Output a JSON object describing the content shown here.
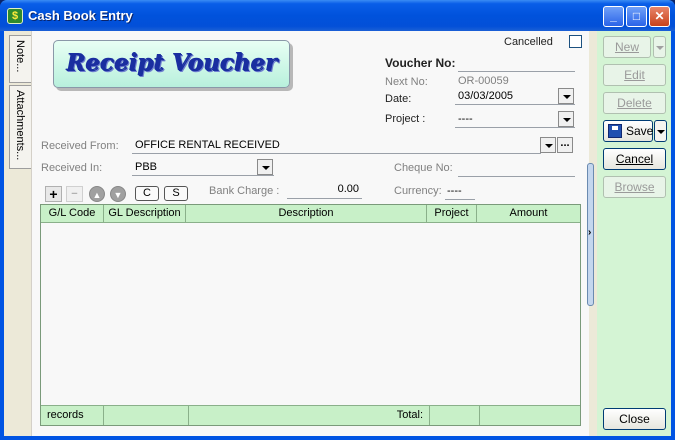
{
  "window": {
    "title": "Cash Book Entry",
    "min": "_",
    "max": "□",
    "close": "✕"
  },
  "side_tabs": {
    "note": "Note...",
    "attachments": "Attachments..."
  },
  "header": {
    "logo_text": "Receipt Voucher",
    "cancelled_label": "Cancelled"
  },
  "voucher": {
    "voucher_no_label": "Voucher No:",
    "voucher_no_value": "",
    "next_no_label": "Next No:",
    "next_no_value": "OR-00059",
    "date_label": "Date:",
    "date_value": "03/03/2005",
    "project_label": "Project :",
    "project_value": "----"
  },
  "form": {
    "received_from_label": "Received From:",
    "received_from_value": "OFFICE RENTAL RECEIVED",
    "dots": "...",
    "received_in_label": "Received In:",
    "received_in_value": "PBB",
    "cheque_no_label": "Cheque No:",
    "cheque_no_value": "",
    "bank_charge_label": "Bank Charge :",
    "bank_charge_value": "0.00",
    "currency_label": "Currency:",
    "currency_value": "----"
  },
  "grid_tools": {
    "add": "+",
    "remove": "−",
    "up": "▲",
    "down": "▼",
    "c": "C",
    "s": "S"
  },
  "grid": {
    "columns": [
      "G/L Code",
      "GL Description",
      "Description",
      "Project",
      "Amount"
    ],
    "footer": {
      "records": "records",
      "total_label": "Total:"
    }
  },
  "actions": {
    "new": "New",
    "edit": "Edit",
    "delete": "Delete",
    "save": "Save",
    "cancel": "Cancel",
    "browse": "Browse",
    "close": "Close"
  },
  "colors": {
    "title_blue": "#0054e3",
    "grid_green": "#c8f0c8",
    "panel_green": "#d4f4d4"
  }
}
